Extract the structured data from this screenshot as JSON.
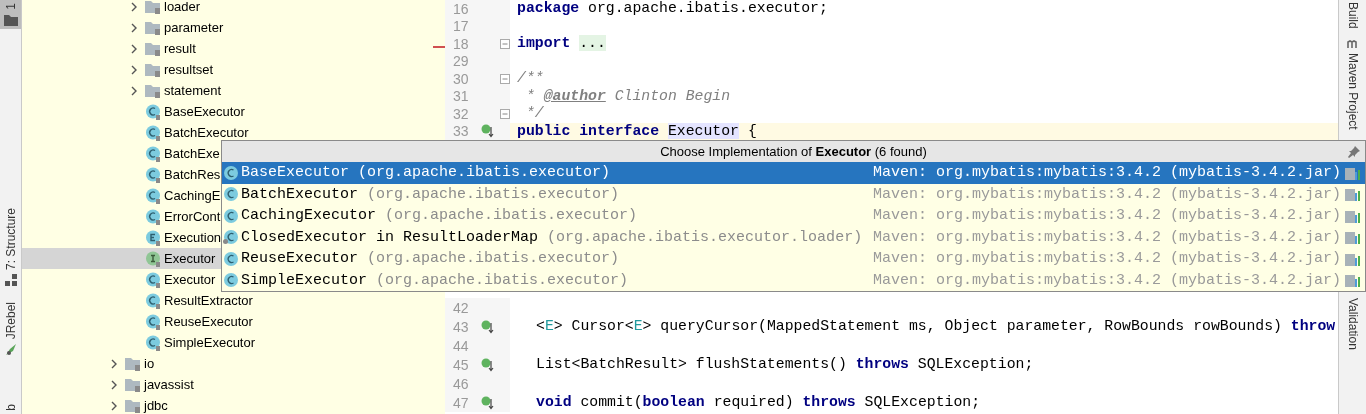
{
  "left_strip": {
    "tabs": [
      {
        "label": "1",
        "selected": true,
        "kind": "project"
      },
      {
        "label": "7: Structure",
        "selected": false,
        "kind": "structure"
      },
      {
        "label": "JRebel",
        "selected": false,
        "kind": "jrebel"
      },
      {
        "label": "b",
        "selected": false,
        "kind": "plain"
      }
    ]
  },
  "tree": [
    {
      "children": [
        {
          "label": "loader",
          "kind": "folder",
          "expanded": false,
          "selected": false
        },
        {
          "label": "parameter",
          "kind": "folder",
          "expanded": false,
          "selected": false
        },
        {
          "label": "result",
          "kind": "folder",
          "expanded": false,
          "selected": false
        },
        {
          "label": "resultset",
          "kind": "folder",
          "expanded": false,
          "selected": false
        },
        {
          "label": "statement",
          "kind": "folder",
          "expanded": false,
          "selected": false
        },
        {
          "label": "BaseExecutor",
          "kind": "class",
          "selected": false
        },
        {
          "label": "BatchExecutor",
          "kind": "class",
          "selected": false
        },
        {
          "label": "BatchExe",
          "kind": "class",
          "selected": false
        },
        {
          "label": "BatchRes",
          "kind": "class",
          "selected": false
        },
        {
          "label": "CachingE",
          "kind": "class",
          "selected": false
        },
        {
          "label": "ErrorCont",
          "kind": "class",
          "selected": false
        },
        {
          "label": "Execution",
          "kind": "enum",
          "selected": false
        },
        {
          "label": "Executor",
          "kind": "interface",
          "selected": true
        },
        {
          "label": "Executor",
          "kind": "class",
          "selected": false
        },
        {
          "label": "ResultExtractor",
          "kind": "class",
          "selected": false
        },
        {
          "label": "ReuseExecutor",
          "kind": "class",
          "selected": false
        },
        {
          "label": "SimpleExecutor",
          "kind": "class",
          "selected": false
        }
      ]
    },
    {
      "label": "io",
      "kind": "folder",
      "expanded": false,
      "selected": false
    },
    {
      "label": "javassist",
      "kind": "folder",
      "expanded": false,
      "selected": false
    },
    {
      "label": "jdbc",
      "kind": "folder",
      "expanded": false,
      "selected": false
    }
  ],
  "editor": {
    "top_lines": [
      {
        "number": "16",
        "kind": "plain",
        "current": false,
        "tokens": [
          {
            "text": "package",
            "kind": "keyword"
          },
          {
            "text": " org.apache.ibatis.executor;",
            "kind": "plain"
          }
        ]
      },
      {
        "number": "17",
        "kind": "plain",
        "current": false
      },
      {
        "number": "18",
        "kind": "fold",
        "current": false,
        "tokens": [
          {
            "text": "import ",
            "kind": "keyword"
          },
          {
            "text": "...",
            "kind": "folded"
          }
        ]
      },
      {
        "number": "29",
        "kind": "plain",
        "current": false
      },
      {
        "number": "30",
        "kind": "fold",
        "current": false,
        "tokens": [
          {
            "text": "/**",
            "kind": "comment"
          }
        ]
      },
      {
        "number": "31",
        "kind": "plain",
        "current": false,
        "tokens": [
          {
            "text": " * ",
            "kind": "comment"
          },
          {
            "text": "@author",
            "kind": "doctag"
          },
          {
            "text": " Clinton Begin",
            "kind": "comment"
          }
        ]
      },
      {
        "number": "32",
        "kind": "fold",
        "current": false,
        "tokens": [
          {
            "text": " */",
            "kind": "comment"
          }
        ]
      },
      {
        "number": "33",
        "kind": "implemented",
        "current": true,
        "tokens": [
          {
            "text": "public interface ",
            "kind": "keyword"
          },
          {
            "text": "Executor",
            "kind": "usage"
          },
          {
            "text": " {",
            "kind": "plain"
          }
        ]
      }
    ],
    "bottom_lines": [
      {
        "number": "42",
        "kind": "plain",
        "current": false
      },
      {
        "number": "43",
        "kind": "implemented",
        "current": false,
        "tokens": [
          {
            "text": "<",
            "kind": "plain"
          },
          {
            "text": "E",
            "kind": "typeparam"
          },
          {
            "text": "> Cursor<",
            "kind": "plain"
          },
          {
            "text": "E",
            "kind": "typeparam"
          },
          {
            "text": "> queryCursor(MappedStatement ms, Object parameter, RowBounds rowBounds) ",
            "kind": "plain"
          },
          {
            "text": "throw",
            "kind": "keyword"
          }
        ]
      },
      {
        "number": "44",
        "kind": "plain",
        "current": false
      },
      {
        "number": "45",
        "kind": "implemented",
        "current": false,
        "tokens": [
          {
            "text": "List<BatchResult> flushStatements() ",
            "kind": "plain"
          },
          {
            "text": "throws",
            "kind": "keyword"
          },
          {
            "text": " SQLException;",
            "kind": "plain"
          }
        ]
      },
      {
        "number": "46",
        "kind": "plain",
        "current": false
      },
      {
        "number": "47",
        "kind": "implemented",
        "current": false,
        "tokens": [
          {
            "text": "void",
            "kind": "keyword"
          },
          {
            "text": " commit(",
            "kind": "plain"
          },
          {
            "text": "boolean",
            "kind": "keyword"
          },
          {
            "text": " required) ",
            "kind": "plain"
          },
          {
            "text": "throws",
            "kind": "keyword"
          },
          {
            "text": " SQLException;",
            "kind": "plain"
          }
        ]
      }
    ]
  },
  "right_strip": {
    "tabs": [
      {
        "label": "Build",
        "kind": "plain"
      },
      {
        "label": "Maven Project",
        "kind": "maven"
      },
      {
        "label": "Validation",
        "kind": "plain"
      }
    ]
  },
  "popup": {
    "title": "Choose Implementation of **Executor** (6 found)",
    "items": [
      {
        "name": "BaseExecutor",
        "package": "(org.apache.ibatis.executor)",
        "location": "Maven: org.mybatis:mybatis:3.4.2 (mybatis-3.4.2.jar)",
        "kind": "class",
        "selected": true
      },
      {
        "name": "BatchExecutor",
        "package": "(org.apache.ibatis.executor)",
        "location": "Maven: org.mybatis:mybatis:3.4.2 (mybatis-3.4.2.jar)",
        "kind": "class",
        "selected": false
      },
      {
        "name": "CachingExecutor",
        "package": "(org.apache.ibatis.executor)",
        "location": "Maven: org.mybatis:mybatis:3.4.2 (mybatis-3.4.2.jar)",
        "kind": "class",
        "selected": false
      },
      {
        "name": "ClosedExecutor in ResultLoaderMap",
        "package": "(org.apache.ibatis.executor.loader)",
        "location": "Maven: org.mybatis:mybatis:3.4.2 (mybatis-3.4.2.jar)",
        "kind": "inner",
        "selected": false
      },
      {
        "name": "ReuseExecutor",
        "package": "(org.apache.ibatis.executor)",
        "location": "Maven: org.mybatis:mybatis:3.4.2 (mybatis-3.4.2.jar)",
        "kind": "class",
        "selected": false
      },
      {
        "name": "SimpleExecutor",
        "package": "(org.apache.ibatis.executor)",
        "location": "Maven: org.mybatis:mybatis:3.4.2 (mybatis-3.4.2.jar)",
        "kind": "class",
        "selected": false
      }
    ]
  }
}
